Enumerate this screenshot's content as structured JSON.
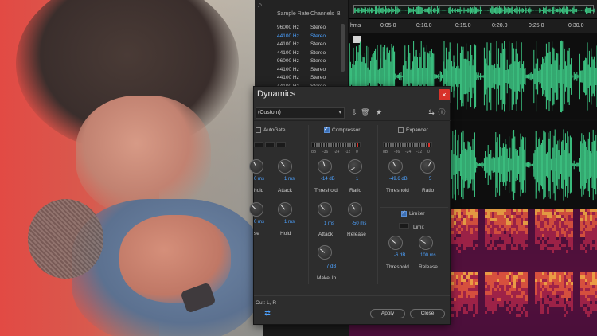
{
  "files": {
    "col_sample_rate": "Sample Rate",
    "col_channels": "Channels",
    "col_extra": "Bi",
    "rows": [
      {
        "sr": "96000 Hz",
        "ch": "Stereo",
        "style": "grey"
      },
      {
        "sr": "44100 Hz",
        "ch": "Stereo",
        "style": "blue"
      },
      {
        "sr": "44100 Hz",
        "ch": "Stereo",
        "style": "grey"
      },
      {
        "sr": "44100 Hz",
        "ch": "Stereo",
        "style": "grey"
      },
      {
        "sr": "96000 Hz",
        "ch": "Stereo",
        "style": "grey"
      },
      {
        "sr": "44100 Hz",
        "ch": "Stereo",
        "style": "grey"
      },
      {
        "sr": "44100 Hz",
        "ch": "Stereo",
        "style": "grey"
      },
      {
        "sr": "44100 Hz",
        "ch": "Stereo",
        "style": "grey"
      }
    ]
  },
  "ruler": {
    "ticks": [
      "hms",
      "0:05.0",
      "0:10.0",
      "0:15.0",
      "0:20.0",
      "0:25.0",
      "0:30.0"
    ]
  },
  "dialog": {
    "title": "Dynamics",
    "close_glyph": "×",
    "preset": "(Custom)",
    "autogate": {
      "label": "AutoGate",
      "enabled": false,
      "knob1_label": "hold",
      "knob1_value": "0 ms",
      "knob2_label": "Attack",
      "knob2_value": "1 ms",
      "knob3_label": "se",
      "knob3_value": "0 ms",
      "knob4_label": "Hold",
      "knob4_value": "1 ms"
    },
    "compressor": {
      "label": "Compressor",
      "enabled": true,
      "scale": [
        "dB",
        "-36",
        "-24",
        "-12",
        "0"
      ],
      "threshold_label": "Threshold",
      "threshold_value": "-14 dB",
      "ratio_label": "Ratio",
      "ratio_value": "1",
      "attack_label": "Attack",
      "attack_value": "1 ms",
      "release_label": "Release",
      "release_value": "-50 ms",
      "makeup_label": "MakeUp",
      "makeup_value": "7 dB"
    },
    "expander": {
      "label": "Expander",
      "enabled": false,
      "scale": [
        "dB",
        "-36",
        "-24",
        "-12",
        "0"
      ],
      "threshold_label": "Threshold",
      "threshold_value": "-49.6 dB",
      "ratio_label": "Ratio",
      "ratio_value": "5"
    },
    "limiter": {
      "label": "Limiter",
      "enabled": true,
      "limit_label": "Limit",
      "threshold_label": "Threshold",
      "threshold_value": "-6 dB",
      "release_label": "Release",
      "release_value": "100 ms"
    },
    "io_label": "Out: L, R",
    "apply_label": "Apply",
    "close_label": "Close"
  },
  "colors": {
    "waveform": "#3fd08a",
    "accent_blue": "#4da2ff",
    "close_red": "#d8322a"
  }
}
